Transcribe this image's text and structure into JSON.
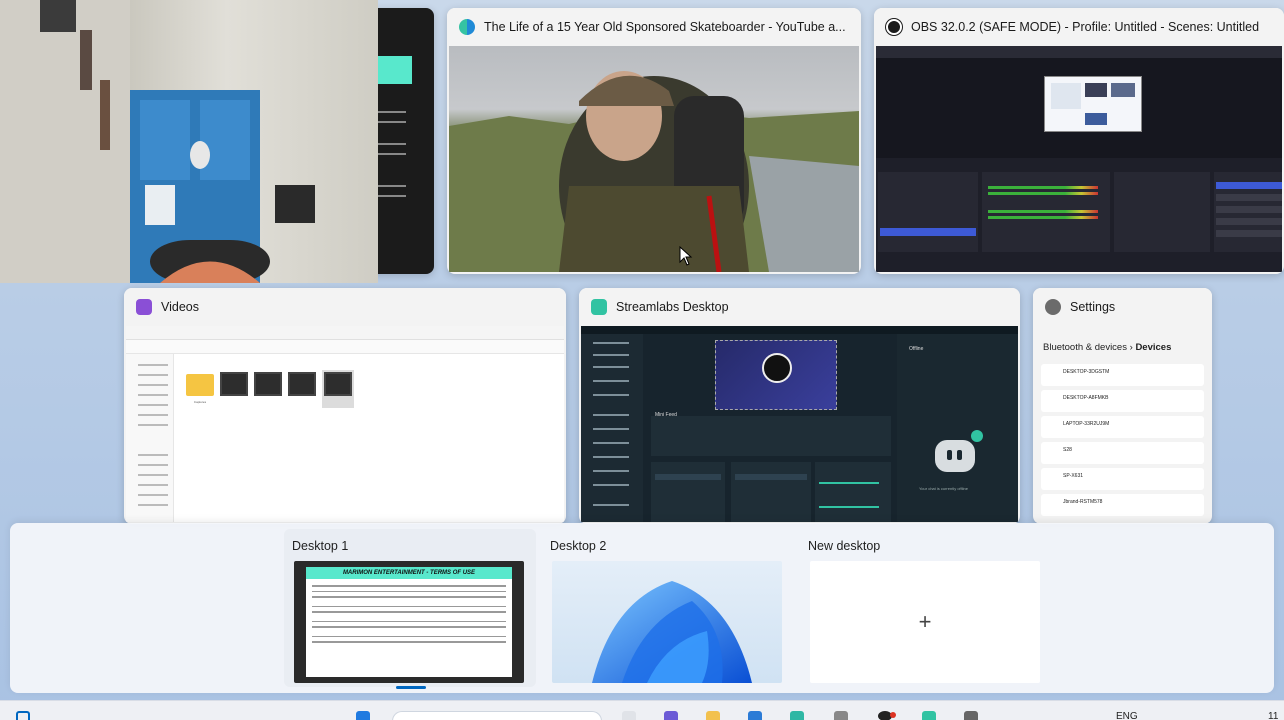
{
  "windows": {
    "youtube": {
      "title": "The Life of a 15 Year Old Sponsored Skateboarder - YouTube a..."
    },
    "obs": {
      "title": "OBS 32.0.2 (SAFE MODE) - Profile: Untitled - Scenes: Untitled"
    },
    "videos": {
      "title": "Videos",
      "folder_label": "Captures"
    },
    "streamlabs": {
      "title": "Streamlabs Desktop",
      "offline_label": "Offline",
      "mini_label": "Mini Feed",
      "offline_message": "Your chat is currently offline"
    },
    "settings": {
      "title": "Settings",
      "breadcrumb_parent": "Bluetooth & devices",
      "breadcrumb_sep": "›",
      "breadcrumb_current": "Devices",
      "devices": [
        "DESKTOP-3DGSTM",
        "DESKTOP-A8FMKB",
        "LAPTOP-33R2UJ9M",
        "S28",
        "SP-X631",
        "Jbrand-RSTM578"
      ]
    }
  },
  "desktops": [
    {
      "label": "Desktop 1",
      "banner": "MARIMON ENTERTAINMENT - TERMS OF USE"
    },
    {
      "label": "Desktop 2"
    }
  ],
  "new_desktop": {
    "label": "New desktop",
    "plus": "+"
  },
  "taskbar": {
    "lang": "ENG",
    "time": "11"
  },
  "colors": {
    "accent": "#0067c0",
    "obs_bg": "#1e1f29",
    "teal": "#31c3a2",
    "youtube_edge": "#1f8ad6"
  }
}
